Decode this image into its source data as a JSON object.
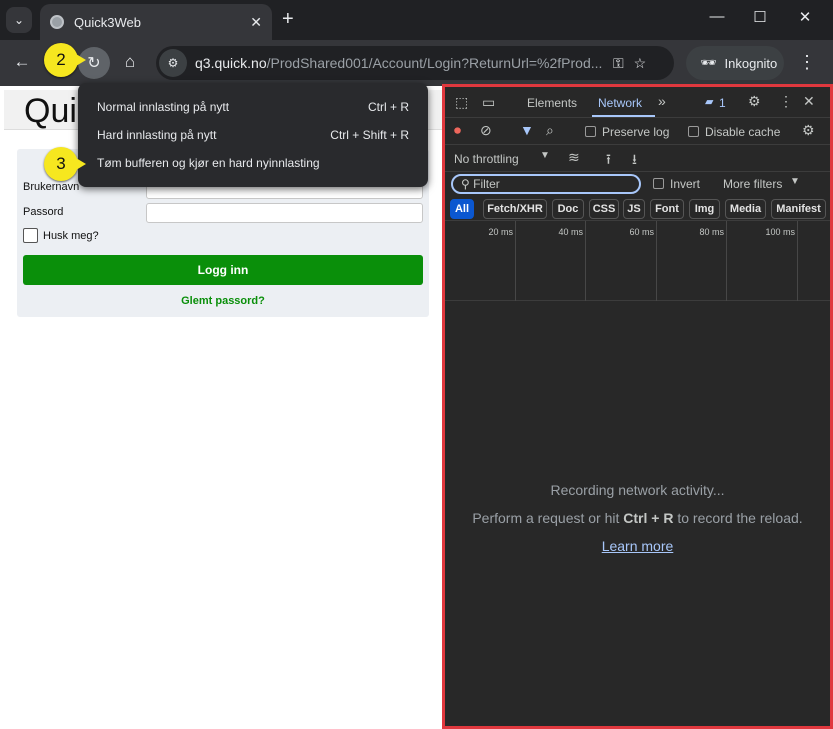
{
  "tab": {
    "title": "Quick3Web"
  },
  "omnibox": {
    "host": "q3.quick.no",
    "path": "/ProdShared001/Account/Login?ReturnUrl=%2fProd..."
  },
  "incognito_label": "Inkognito",
  "badges": {
    "step2": "2",
    "step3": "3"
  },
  "reload_menu": {
    "items": [
      {
        "label": "Normal innlasting på nytt",
        "shortcut": "Ctrl + R"
      },
      {
        "label": "Hard innlasting på nytt",
        "shortcut": "Ctrl + Shift + R"
      },
      {
        "label": "Tøm bufferen og kjør en hard nyinnlasting",
        "shortcut": ""
      }
    ]
  },
  "page": {
    "logo_text": "Qui",
    "username_label": "Brukernavn",
    "password_label": "Passord",
    "remember_label": "Husk meg?",
    "login_button": "Logg inn",
    "forgot_link": "Glemt passord?"
  },
  "devtools": {
    "tabs": [
      "Elements",
      "Network"
    ],
    "active_tab": "Network",
    "issues_count": "1",
    "preserve_log": "Preserve log",
    "disable_cache": "Disable cache",
    "throttling": "No throttling",
    "filter_placeholder": "Filter",
    "invert": "Invert",
    "more_filters": "More filters",
    "type_filters": [
      "All",
      "Fetch/XHR",
      "Doc",
      "CSS",
      "JS",
      "Font",
      "Img",
      "Media",
      "Manifest"
    ],
    "timeline_ticks": [
      "20 ms",
      "40 ms",
      "60 ms",
      "80 ms",
      "100 ms"
    ],
    "empty_title": "Recording network activity...",
    "empty_hint_pre": "Perform a request or hit",
    "empty_hint_keys": "Ctrl + R",
    "empty_hint_post": "to record the reload.",
    "learn_more": "Learn more"
  },
  "colors": {
    "accent_red": "#e0383e",
    "badge_yellow": "#f6e71f",
    "login_green": "#0a8f0a",
    "devtools_blue": "#a8c7fa"
  }
}
